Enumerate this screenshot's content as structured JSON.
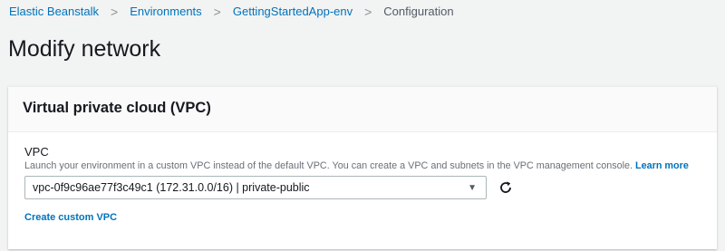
{
  "breadcrumb": {
    "items": [
      {
        "label": "Elastic Beanstalk"
      },
      {
        "label": "Environments"
      },
      {
        "label": "GettingStartedApp-env"
      },
      {
        "label": "Configuration"
      }
    ],
    "separator": ">"
  },
  "page": {
    "title": "Modify network"
  },
  "vpc_panel": {
    "title": "Virtual private cloud (VPC)",
    "field_label": "VPC",
    "description": "Launch your environment in a custom VPC instead of the default VPC. You can create a VPC and subnets in the VPC management console.",
    "learn_more": "Learn more",
    "select_value": "vpc-0f9c96ae77f3c49c1 (172.31.0.0/16) | private-public",
    "select_arrow": "▼",
    "refresh_icon": "refresh-icon",
    "create_link": "Create custom VPC"
  },
  "colors": {
    "link": "#0073bb",
    "background": "#f2f3f3",
    "panel": "#ffffff",
    "text": "#16191f",
    "muted": "#687078"
  }
}
